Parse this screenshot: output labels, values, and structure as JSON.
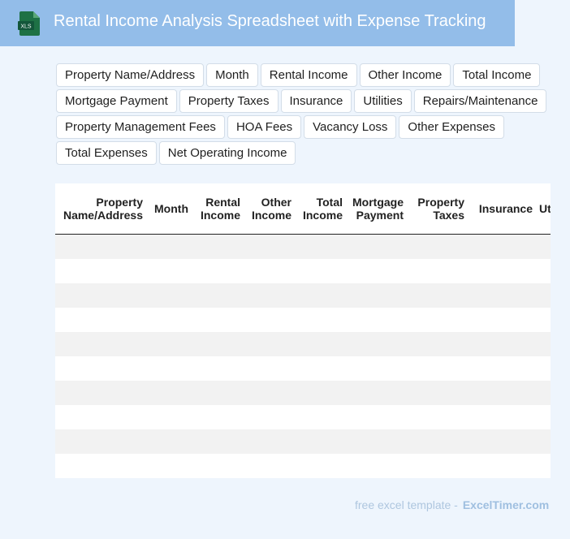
{
  "header": {
    "icon_label": "XLS",
    "title": "Rental Income Analysis Spreadsheet with Expense Tracking",
    "icon_color": "#1e7145",
    "background": "#93bde9"
  },
  "tags": [
    "Property Name/Address",
    "Month",
    "Rental Income",
    "Other Income",
    "Total Income",
    "Mortgage Payment",
    "Property Taxes",
    "Insurance",
    "Utilities",
    "Repairs/Maintenance",
    "Property Management Fees",
    "HOA Fees",
    "Vacancy Loss",
    "Other Expenses",
    "Total Expenses",
    "Net Operating Income"
  ],
  "table": {
    "columns": [
      [
        "Property",
        "Name/Address"
      ],
      [
        "Month"
      ],
      [
        "Rental",
        "Income"
      ],
      [
        "Other",
        "Income"
      ],
      [
        "Total",
        "Income"
      ],
      [
        "Mortgage",
        "Payment"
      ],
      [
        "Property",
        "Taxes"
      ],
      [
        "Insurance"
      ],
      [
        "Utilities"
      ]
    ],
    "row_count": 10
  },
  "footer": {
    "prefix": "free excel template -",
    "brand": "ExcelTimer.com"
  }
}
